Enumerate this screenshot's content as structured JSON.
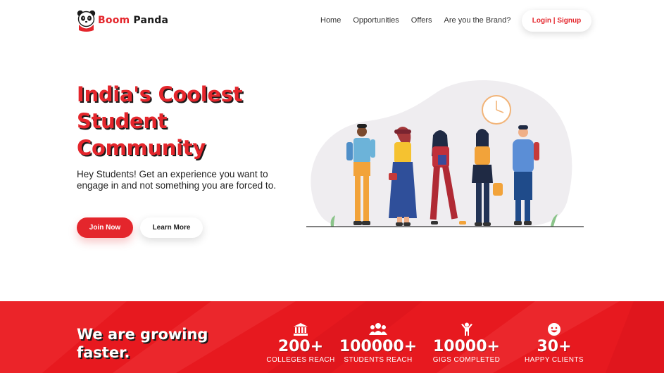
{
  "brand": {
    "name_part1": "Boom",
    "name_part2": "Panda",
    "logo_icon": "panda-logo-icon"
  },
  "nav": {
    "links": [
      {
        "label": "Home"
      },
      {
        "label": "Opportunities"
      },
      {
        "label": "Offers"
      },
      {
        "label": "Are you the Brand?"
      }
    ],
    "login_label": "Login | Signup"
  },
  "hero": {
    "title": "India's Coolest Student Community",
    "subtitle": "Hey Students! Get an experience you want to engage in and not something you are forced to.",
    "join_label": "Join Now",
    "learn_label": "Learn More",
    "illustration": "students-group-illustration"
  },
  "stats_band": {
    "title": "We are growing faster.",
    "stats": [
      {
        "icon": "college-building-icon",
        "value": "200+",
        "label": "COLLEGES REACH"
      },
      {
        "icon": "students-group-icon",
        "value": "100000+",
        "label": "STUDENTS REACH"
      },
      {
        "icon": "person-achievement-icon",
        "value": "10000+",
        "label": "GIGS COMPLETED"
      },
      {
        "icon": "smiley-face-icon",
        "value": "30+",
        "label": "HAPPY CLIENTS"
      }
    ]
  },
  "colors": {
    "accent": "#e4262c",
    "band": "#e7191f",
    "text": "#222222"
  }
}
